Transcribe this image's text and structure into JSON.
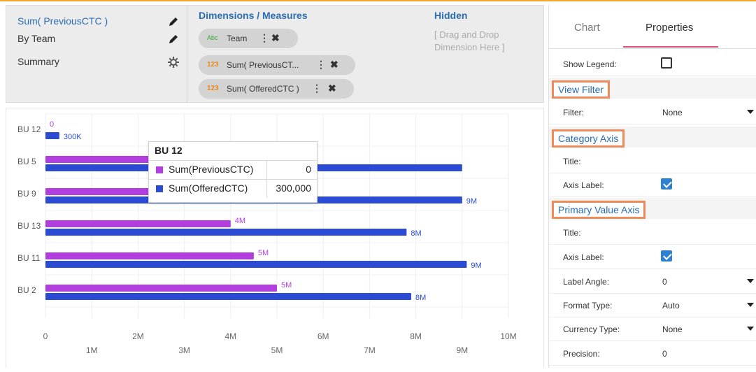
{
  "config": {
    "left_items": [
      {
        "label": "Sum( PreviousCTC )",
        "icon": "pencil-icon",
        "color": "#2a6db5"
      },
      {
        "label": "By Team",
        "icon": "pencil-icon",
        "color": "#333333"
      },
      {
        "label": "Summary",
        "icon": "gear-icon",
        "color": "#333333"
      }
    ],
    "dimensions": {
      "title": "Dimensions / Measures",
      "pills": [
        {
          "type": "Abc",
          "label": "Team"
        },
        {
          "type": "123",
          "label": "Sum( PreviousCT..."
        },
        {
          "type": "123",
          "label": "Sum( OfferedCTC )"
        }
      ]
    },
    "hidden": {
      "title": "Hidden",
      "hint": "[ Drag and Drop Dimension Here ]"
    }
  },
  "chart_data": {
    "type": "bar",
    "orientation": "horizontal",
    "categories": [
      "BU 12",
      "BU 5",
      "BU 9",
      "BU 13",
      "BU 11",
      "BU 2"
    ],
    "series": [
      {
        "name": "Sum(PreviousCTC)",
        "color": "#b23ee0",
        "values": [
          0,
          2500000,
          3500000,
          4000000,
          4500000,
          5000000
        ],
        "labels": [
          "0",
          "",
          "",
          "4M",
          "5M",
          "5M"
        ]
      },
      {
        "name": "Sum(OfferedCTC)",
        "color": "#2b4bd4",
        "values": [
          300000,
          9000000,
          9000000,
          7800000,
          9100000,
          7900000
        ],
        "labels": [
          "300K",
          "",
          "9M",
          "8M",
          "9M",
          "8M"
        ]
      }
    ],
    "xlim": [
      0,
      10000000
    ],
    "xticks_major": [
      "0",
      "2M",
      "4M",
      "6M",
      "8M",
      "10M"
    ],
    "xticks_minor": [
      "1M",
      "3M",
      "5M",
      "7M",
      "9M"
    ],
    "grid": true,
    "legend": false
  },
  "tooltip": {
    "title": "BU 12",
    "rows": [
      {
        "name": "Sum(PreviousCTC)",
        "value": "0",
        "color": "#b23ee0"
      },
      {
        "name": "Sum(OfferedCTC)",
        "value": "300,000",
        "color": "#2b4bd4"
      }
    ]
  },
  "properties": {
    "tabs": [
      "Chart",
      "Properties"
    ],
    "active_tab": "Properties",
    "show_legend_label": "Show Legend:",
    "show_legend_checked": false,
    "view_filter": {
      "title": "View Filter",
      "filter_label": "Filter:",
      "filter_value": "None"
    },
    "category_axis": {
      "title": "Category Axis",
      "title_label": "Title:",
      "axis_label_label": "Axis Label:",
      "axis_label_checked": true
    },
    "primary_value_axis": {
      "title": "Primary Value Axis",
      "title_label": "Title:",
      "axis_label_label": "Axis Label:",
      "axis_label_checked": true,
      "label_angle_label": "Label Angle:",
      "label_angle_value": "0",
      "format_type_label": "Format Type:",
      "format_type_value": "Auto",
      "currency_type_label": "Currency Type:",
      "currency_type_value": "None",
      "precision_label": "Precision:",
      "precision_value": "0"
    }
  }
}
